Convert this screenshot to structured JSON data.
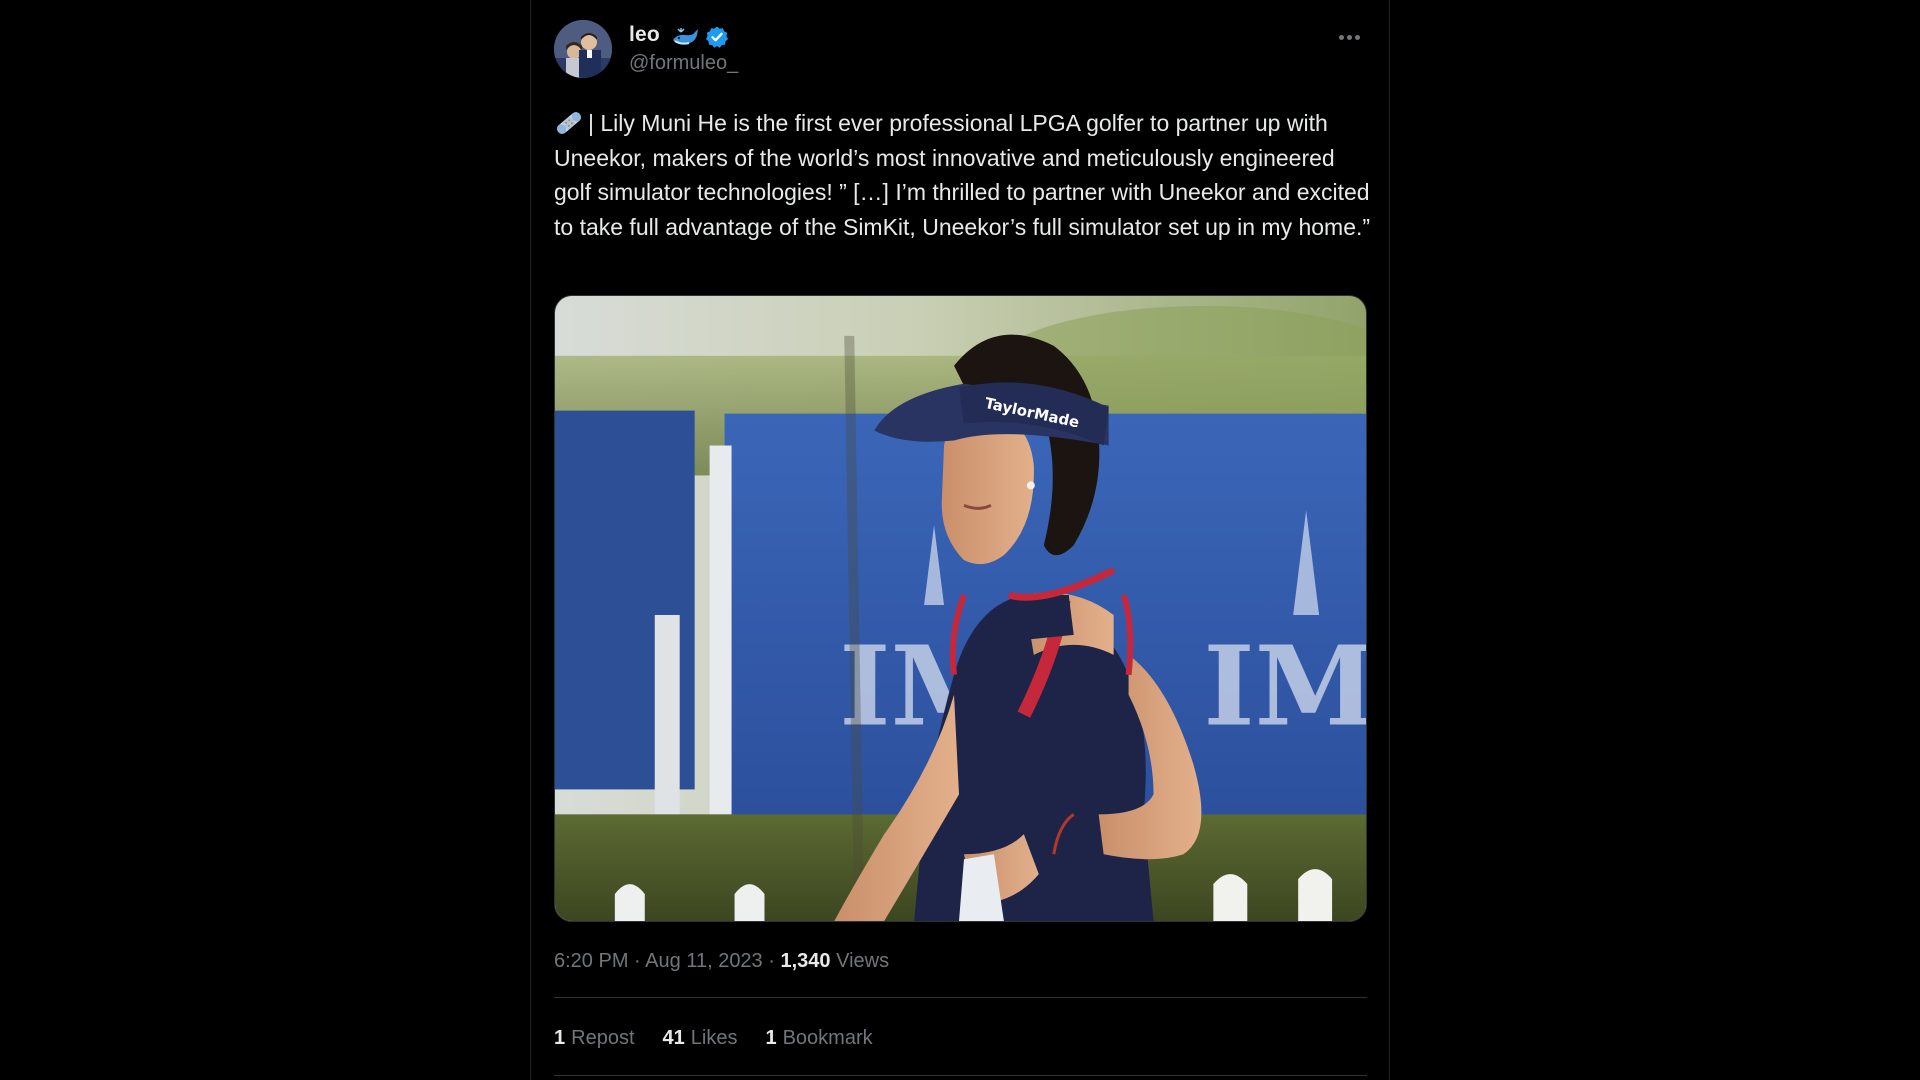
{
  "tweet": {
    "author": {
      "display_name": "leo",
      "handle": "@formuleo_",
      "name_emoji": "whale-emoji",
      "verified_badge": "verified-icon",
      "avatar": "avatar"
    },
    "more_icon": "more-horizontal-icon",
    "text_prefix_icon": "adhesive-bandage-emoji",
    "text": "| Lily Muni He is the first ever professional LPGA golfer to partner up with Uneekor, makers of the world’s most innovative and meticulously engineered golf simulator technologies! ” […] I’m thrilled to partner with Uneekor and excited to take full advantage of the SimKit, Uneekor’s full simulator set up in my home.”",
    "media": {
      "visor_brand_text": "TaylorMade",
      "banner_text_left": "IM",
      "banner_text_right": "IMG"
    },
    "time": "6:20 PM",
    "separator": "·",
    "date": "Aug 11, 2023",
    "views_count": "1,340",
    "views_label": "Views",
    "stats": {
      "reposts_count": "1",
      "reposts_label": "Repost",
      "likes_count": "41",
      "likes_label": "Likes",
      "bookmarks_count": "1",
      "bookmarks_label": "Bookmark"
    }
  },
  "colors": {
    "background": "#000000",
    "text_primary": "#e7e9ea",
    "text_secondary": "#71767b",
    "verified_blue": "#1d9bf0",
    "divider": "#2f3336"
  }
}
